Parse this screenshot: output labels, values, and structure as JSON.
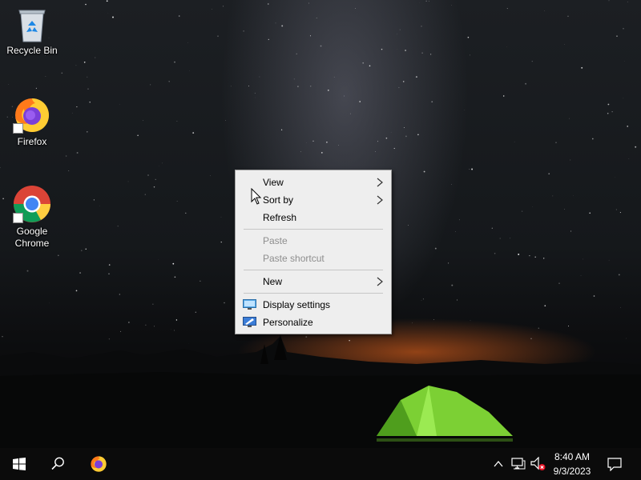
{
  "desktop": {
    "icons": [
      {
        "label": "Recycle Bin",
        "icon": "recycle-bin-icon"
      },
      {
        "label": "Firefox",
        "icon": "firefox-icon"
      },
      {
        "label": "Google Chrome",
        "icon": "chrome-icon"
      }
    ]
  },
  "context_menu": {
    "items": [
      {
        "label": "View",
        "submenu": true,
        "enabled": true
      },
      {
        "label": "Sort by",
        "submenu": true,
        "enabled": true
      },
      {
        "label": "Refresh",
        "submenu": false,
        "enabled": true
      },
      {
        "label": "Paste",
        "submenu": false,
        "enabled": false
      },
      {
        "label": "Paste shortcut",
        "submenu": false,
        "enabled": false
      },
      {
        "label": "New",
        "submenu": true,
        "enabled": true
      },
      {
        "label": "Display settings",
        "submenu": false,
        "enabled": true,
        "icon": "display-icon"
      },
      {
        "label": "Personalize",
        "submenu": false,
        "enabled": true,
        "icon": "personalize-icon"
      }
    ]
  },
  "taskbar": {
    "start": "windows-logo-icon",
    "search": "search-icon",
    "pinned": [
      "firefox-icon"
    ],
    "tray": {
      "icons": [
        "chevron-up-icon",
        "network-icon",
        "volume-muted-icon"
      ],
      "time": "8:40 AM",
      "date": "9/3/2023"
    },
    "notifications": "notification-icon"
  },
  "colors": {
    "taskbar": "#0b0b0b",
    "menu_background": "#eeeeee",
    "menu_disabled_text": "#8e8e8e"
  }
}
